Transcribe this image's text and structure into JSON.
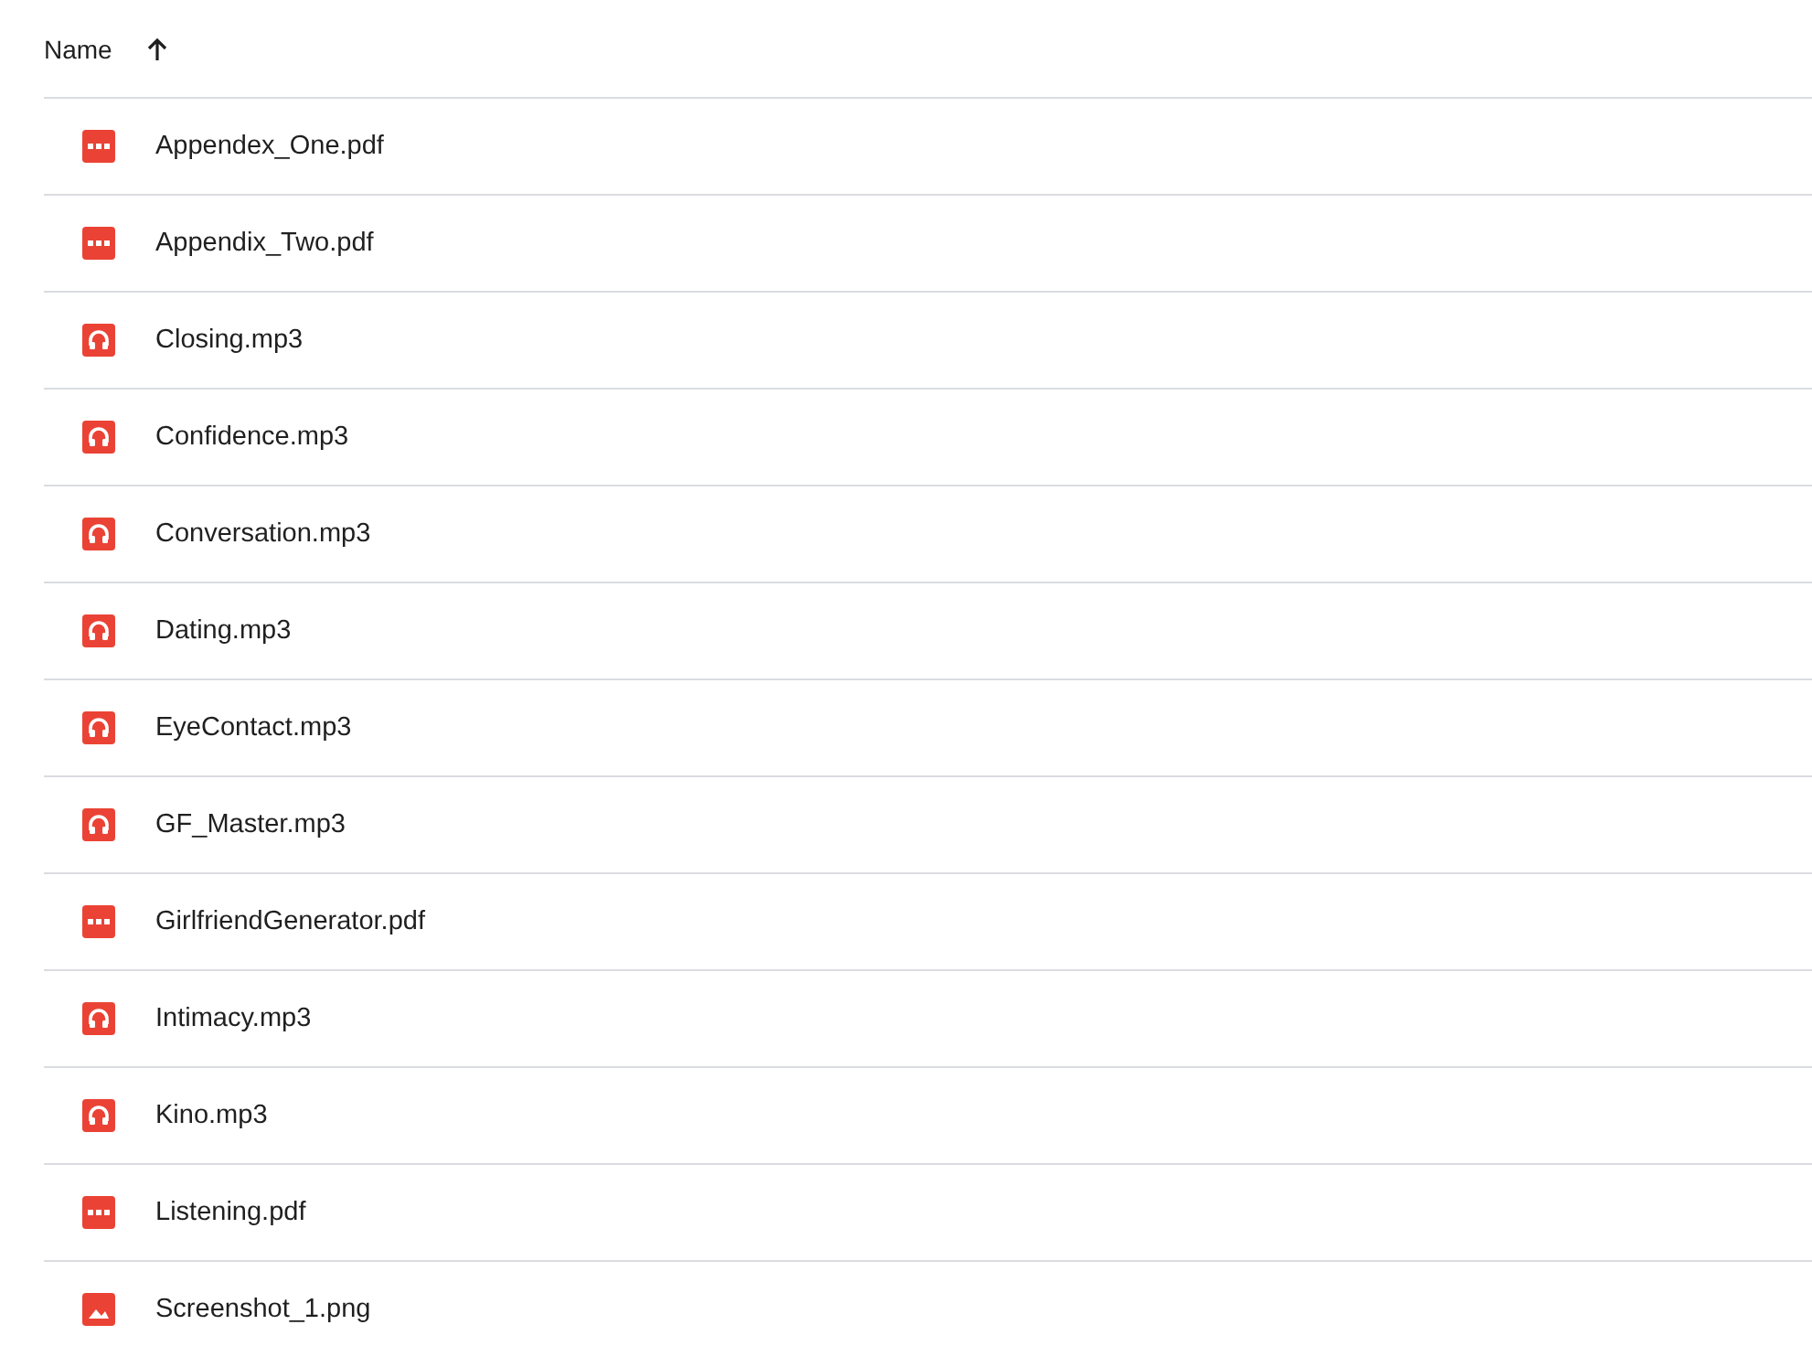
{
  "header": {
    "label": "Name",
    "ascending": true
  },
  "files": [
    {
      "name": "Appendex_One.pdf",
      "kind": "pdf"
    },
    {
      "name": "Appendix_Two.pdf",
      "kind": "pdf"
    },
    {
      "name": "Closing.mp3",
      "kind": "audio"
    },
    {
      "name": "Confidence.mp3",
      "kind": "audio"
    },
    {
      "name": "Conversation.mp3",
      "kind": "audio"
    },
    {
      "name": "Dating.mp3",
      "kind": "audio"
    },
    {
      "name": "EyeContact.mp3",
      "kind": "audio"
    },
    {
      "name": "GF_Master.mp3",
      "kind": "audio"
    },
    {
      "name": "GirlfriendGenerator.pdf",
      "kind": "pdf"
    },
    {
      "name": "Intimacy.mp3",
      "kind": "audio"
    },
    {
      "name": "Kino.mp3",
      "kind": "audio"
    },
    {
      "name": "Listening.pdf",
      "kind": "pdf"
    },
    {
      "name": "Screenshot_1.png",
      "kind": "image"
    }
  ]
}
